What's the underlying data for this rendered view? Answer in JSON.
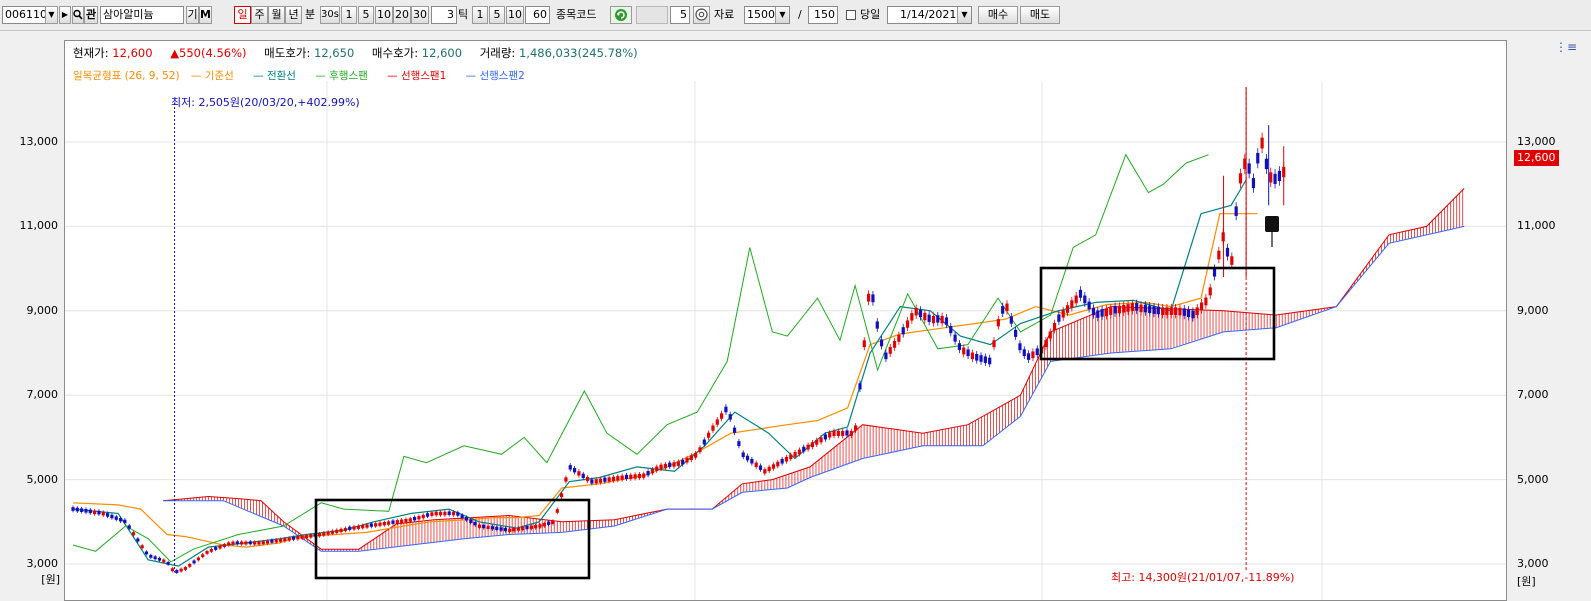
{
  "toolbar": {
    "stock_code": "006110",
    "gwan_label": "관",
    "stock_name": "삼아알미늄",
    "gi_label": "기",
    "m_label": "M",
    "period_tabs": [
      "일",
      "주",
      "월",
      "년",
      "분",
      "30s",
      "1",
      "5",
      "10",
      "20",
      "30"
    ],
    "tick_value": "3",
    "tick_label": "틱",
    "tick_buttons": [
      "1",
      "5",
      "10"
    ],
    "minute_value": "60",
    "code_label": "종목코드",
    "count_value": "5",
    "data_label": "자료",
    "data_count": "1500",
    "slash": "/",
    "page_size": "150",
    "today_label": "당일",
    "date_value": "1/14/2021",
    "buy_label": "매수",
    "sell_label": "매도"
  },
  "info": {
    "current_label": "현재가:",
    "current_value": "12,600",
    "change_value": "▲550(4.56%)",
    "ask_label": "매도호가:",
    "ask_value": "12,650",
    "bid_label": "매수호가:",
    "bid_value": "12,600",
    "volume_label": "거래량:",
    "volume_value": "1,486,033(245.78%)"
  },
  "legend": {
    "title": "일목균형표 (26, 9, 52)",
    "items": [
      "기준선",
      "전환선",
      "후행스팬",
      "선행스팬1",
      "선행스팬2"
    ]
  },
  "annotations": {
    "low": "최저: 2,505원(20/03/20,+402.99%)",
    "high": "최고: 14,300원(21/01/07,-11.89%)"
  },
  "axis": {
    "ticks": [
      "13,000",
      "11,000",
      "9,000",
      "7,000",
      "5,000",
      "3,000"
    ],
    "unit": "[원]",
    "current_price": "12,600"
  },
  "colors": {
    "up": "#e00000",
    "down": "#1010c0",
    "kijun": "#ff8c00",
    "tenkan": "#008080",
    "chikou": "#22aa22",
    "span1": "#e00000",
    "span2": "#3366ff"
  },
  "chart_data": {
    "type": "line",
    "ylim": [
      2750,
      14500
    ],
    "n": 300,
    "kijun": [
      [
        0,
        4450
      ],
      [
        12,
        4400
      ],
      [
        18,
        4300
      ],
      [
        25,
        3700
      ],
      [
        30,
        3650
      ],
      [
        40,
        3450
      ],
      [
        46,
        3400
      ],
      [
        55,
        3500
      ],
      [
        60,
        3650
      ],
      [
        70,
        3700
      ],
      [
        78,
        3750
      ],
      [
        88,
        3900
      ],
      [
        95,
        4000
      ],
      [
        105,
        4050
      ],
      [
        112,
        4100
      ],
      [
        118,
        4100
      ],
      [
        124,
        4150
      ],
      [
        130,
        4800
      ],
      [
        140,
        4900
      ],
      [
        152,
        5100
      ],
      [
        158,
        5300
      ],
      [
        165,
        5600
      ],
      [
        175,
        6100
      ],
      [
        190,
        6300
      ],
      [
        198,
        6400
      ],
      [
        206,
        6700
      ],
      [
        212,
        8200
      ],
      [
        220,
        8450
      ],
      [
        232,
        8600
      ],
      [
        240,
        8700
      ],
      [
        248,
        8800
      ],
      [
        256,
        9100
      ],
      [
        265,
        8900
      ],
      [
        275,
        9150
      ],
      [
        285,
        9200
      ],
      [
        292,
        9100
      ],
      [
        300,
        9300
      ],
      [
        305,
        11300
      ],
      [
        315,
        11300
      ]
    ],
    "tenkan": [
      [
        0,
        4300
      ],
      [
        12,
        4200
      ],
      [
        20,
        3100
      ],
      [
        28,
        2950
      ],
      [
        36,
        3400
      ],
      [
        46,
        3500
      ],
      [
        55,
        3600
      ],
      [
        62,
        3700
      ],
      [
        72,
        3800
      ],
      [
        80,
        4000
      ],
      [
        90,
        4200
      ],
      [
        100,
        4300
      ],
      [
        108,
        4000
      ],
      [
        118,
        3850
      ],
      [
        124,
        4000
      ],
      [
        132,
        4950
      ],
      [
        140,
        5050
      ],
      [
        150,
        5300
      ],
      [
        160,
        5200
      ],
      [
        168,
        5800
      ],
      [
        176,
        6600
      ],
      [
        185,
        6100
      ],
      [
        192,
        5500
      ],
      [
        200,
        6100
      ],
      [
        206,
        6250
      ],
      [
        212,
        8000
      ],
      [
        220,
        9100
      ],
      [
        228,
        9000
      ],
      [
        236,
        8400
      ],
      [
        244,
        8200
      ],
      [
        252,
        8700
      ],
      [
        262,
        9000
      ],
      [
        272,
        9200
      ],
      [
        282,
        9250
      ],
      [
        292,
        9000
      ],
      [
        300,
        11300
      ],
      [
        308,
        11500
      ],
      [
        312,
        12100
      ]
    ],
    "chikou": [
      [
        0,
        3450
      ],
      [
        6,
        3300
      ],
      [
        14,
        3900
      ],
      [
        20,
        3600
      ],
      [
        26,
        3050
      ],
      [
        32,
        3350
      ],
      [
        44,
        3700
      ],
      [
        56,
        3900
      ],
      [
        66,
        4450
      ],
      [
        72,
        4300
      ],
      [
        84,
        4250
      ],
      [
        88,
        5550
      ],
      [
        94,
        5400
      ],
      [
        104,
        5800
      ],
      [
        114,
        5600
      ],
      [
        120,
        6000
      ],
      [
        126,
        5400
      ],
      [
        136,
        7100
      ],
      [
        142,
        6100
      ],
      [
        150,
        5600
      ],
      [
        158,
        6300
      ],
      [
        166,
        6600
      ],
      [
        174,
        7800
      ],
      [
        180,
        10500
      ],
      [
        186,
        8500
      ],
      [
        190,
        8400
      ],
      [
        198,
        9300
      ],
      [
        204,
        8300
      ],
      [
        208,
        9600
      ],
      [
        214,
        7600
      ],
      [
        222,
        9400
      ],
      [
        230,
        8100
      ],
      [
        238,
        8200
      ],
      [
        246,
        9300
      ],
      [
        252,
        8500
      ],
      [
        260,
        8900
      ],
      [
        266,
        10500
      ],
      [
        272,
        10800
      ],
      [
        280,
        12700
      ],
      [
        286,
        11800
      ],
      [
        290,
        12000
      ],
      [
        296,
        12500
      ],
      [
        302,
        12700
      ]
    ],
    "span1": [
      [
        24,
        4500
      ],
      [
        36,
        4600
      ],
      [
        44,
        4550
      ],
      [
        50,
        4500
      ],
      [
        56,
        4000
      ],
      [
        66,
        3350
      ],
      [
        76,
        3350
      ],
      [
        86,
        3950
      ],
      [
        96,
        4050
      ],
      [
        106,
        4100
      ],
      [
        116,
        4150
      ],
      [
        130,
        4000
      ],
      [
        144,
        4050
      ],
      [
        158,
        4300
      ],
      [
        170,
        4300
      ],
      [
        178,
        4900
      ],
      [
        186,
        5000
      ],
      [
        196,
        5300
      ],
      [
        210,
        6300
      ],
      [
        226,
        6100
      ],
      [
        238,
        6300
      ],
      [
        252,
        7000
      ],
      [
        260,
        8500
      ],
      [
        276,
        9100
      ],
      [
        292,
        9050
      ],
      [
        306,
        9000
      ],
      [
        320,
        8900
      ],
      [
        336,
        9100
      ],
      [
        350,
        10800
      ],
      [
        360,
        11000
      ],
      [
        370,
        11900
      ]
    ],
    "span2": [
      [
        24,
        4500
      ],
      [
        40,
        4500
      ],
      [
        56,
        3900
      ],
      [
        66,
        3300
      ],
      [
        76,
        3300
      ],
      [
        90,
        3450
      ],
      [
        104,
        3600
      ],
      [
        116,
        3700
      ],
      [
        130,
        3750
      ],
      [
        144,
        3900
      ],
      [
        158,
        4300
      ],
      [
        170,
        4300
      ],
      [
        178,
        4700
      ],
      [
        190,
        4800
      ],
      [
        196,
        5050
      ],
      [
        210,
        5500
      ],
      [
        226,
        5800
      ],
      [
        242,
        5800
      ],
      [
        252,
        6500
      ],
      [
        260,
        7800
      ],
      [
        276,
        8000
      ],
      [
        292,
        8100
      ],
      [
        306,
        8500
      ],
      [
        320,
        8600
      ],
      [
        336,
        9100
      ],
      [
        350,
        10600
      ],
      [
        370,
        11000
      ]
    ],
    "candles_summary": "Daily candlesticks from ~4,300 (Mar 2020) to 12,600 (Jan 2021); low 2,505, high 14,300"
  }
}
